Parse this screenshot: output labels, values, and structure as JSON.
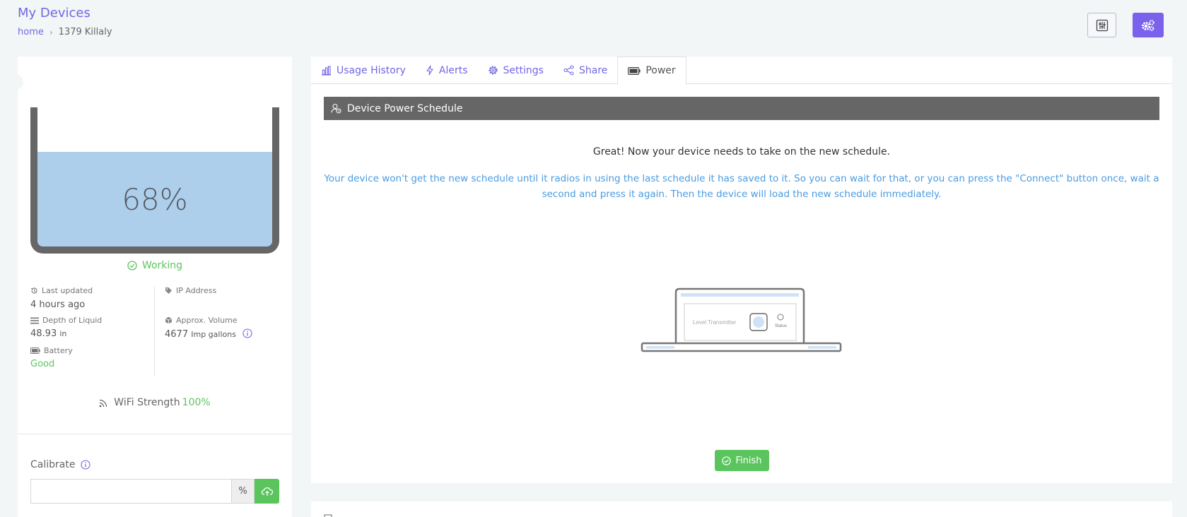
{
  "header": {
    "title": "My Devices",
    "breadcrumb": {
      "home": "home",
      "separator": "›",
      "current": "1379 Killaly"
    },
    "buttons": [
      {
        "icon": "sliders-icon",
        "style": "outline"
      },
      {
        "icon": "cogs-icon",
        "style": "primary"
      }
    ]
  },
  "tank": {
    "level_percent": 68,
    "label": "68%",
    "status": "Working"
  },
  "stats": {
    "last_updated": {
      "label": "Last updated",
      "value": "4 hours ago"
    },
    "ip_address": {
      "label": "IP Address",
      "value": ""
    },
    "depth": {
      "label": "Depth of Liquid",
      "value": "48.93",
      "unit": "in"
    },
    "volume": {
      "label": "Approx. Volume",
      "value": "4677",
      "unit": "Imp gallons"
    },
    "battery": {
      "label": "Battery",
      "value": "Good"
    }
  },
  "wifi": {
    "label": "WiFi Strength",
    "value": "100%"
  },
  "calibrate": {
    "label": "Calibrate",
    "value": "",
    "addon": "%"
  },
  "tabs": [
    {
      "label": "Usage History",
      "icon": "bar-chart-icon",
      "active": false
    },
    {
      "label": "Alerts",
      "icon": "bolt-icon",
      "active": false
    },
    {
      "label": "Settings",
      "icon": "gear-icon",
      "active": false
    },
    {
      "label": "Share",
      "icon": "share-icon",
      "active": false
    },
    {
      "label": "Power",
      "icon": "battery-icon",
      "active": true
    }
  ],
  "power": {
    "section_title": "Device Power Schedule",
    "message_title": "Great! Now your device needs to take on the new schedule.",
    "message_body": "Your device won't get the new schedule until it radios in using the last schedule it has saved to it. So you can wait for that, or you can press the \"Connect\" button once, wait a second and press it again. Then the device will load the new schedule immediately.",
    "device": {
      "label": "Level Transmitter",
      "status_label": "Status"
    },
    "finish_label": "Finish"
  },
  "colors": {
    "accent": "#7266e4",
    "primary_button": "#7b62ec",
    "success": "#5bc55d",
    "info_text": "#4a9be0",
    "section_bar": "#666666",
    "tank_fill": "#aecfeb"
  }
}
